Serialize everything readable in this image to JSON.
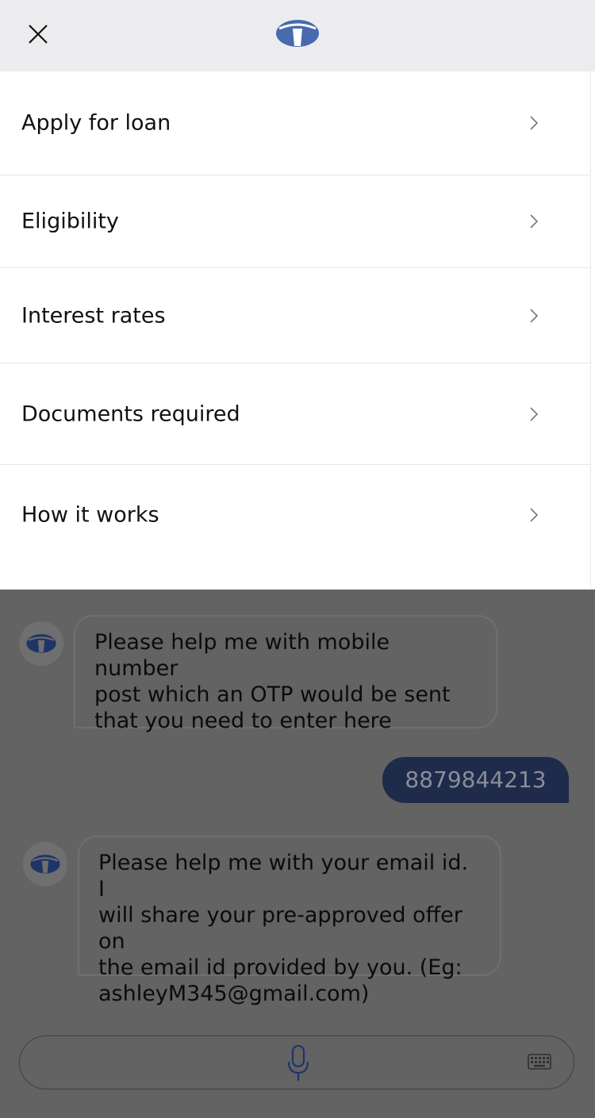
{
  "header": {
    "close_icon": "close-icon",
    "logo": "tata-logo"
  },
  "menu": {
    "items": [
      {
        "label": "Apply for loan"
      },
      {
        "label": "Eligibility"
      },
      {
        "label": "Interest rates"
      },
      {
        "label": "Documents required"
      },
      {
        "label": "How it works"
      }
    ]
  },
  "chat": {
    "messages": [
      {
        "from": "bot",
        "lines": [
          "Please help me with mobile number",
          "post which an OTP would be sent",
          "that you need to enter here"
        ]
      },
      {
        "from": "user",
        "text": "8879844213"
      },
      {
        "from": "bot",
        "lines": [
          "Please help me with your email id. I",
          "will share your pre-approved offer on",
          "the email id provided by you. (Eg:",
          "ashleyM345@gmail.com)"
        ]
      }
    ]
  },
  "input_bar": {
    "mic_icon": "microphone-icon",
    "keyboard_icon": "keyboard-icon"
  },
  "colors": {
    "brand": "#486aaf",
    "overlay": "#636363",
    "user_bubble": "#1f2b4a"
  }
}
